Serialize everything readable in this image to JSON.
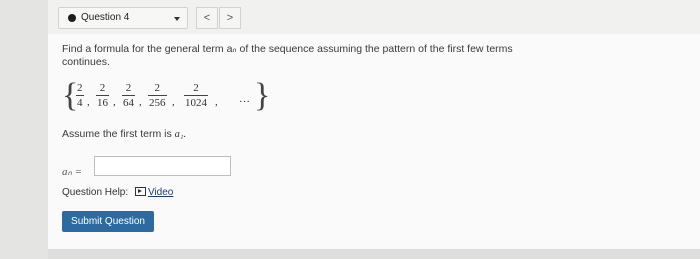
{
  "header": {
    "question_label": "Question 4",
    "prev_label": "<",
    "next_label": ">"
  },
  "question": {
    "prompt": "Find a formula for the general term aₙ of the sequence assuming the pattern of the first few terms continues.",
    "sequence": [
      {
        "num": "2",
        "den": "4"
      },
      {
        "num": "2",
        "den": "16"
      },
      {
        "num": "2",
        "den": "64"
      },
      {
        "num": "2",
        "den": "256"
      },
      {
        "num": "2",
        "den": "1024"
      }
    ],
    "ellipsis": "…",
    "assume_text": "Assume the first term is ",
    "assume_term": "a₁.",
    "answer_label": "aₙ =",
    "answer_value": ""
  },
  "help": {
    "label": "Question Help:",
    "video_icon": "video-play-icon",
    "video_label": "Video"
  },
  "actions": {
    "submit_label": "Submit Question"
  },
  "colors": {
    "submit_bg": "#2c6aa0",
    "link": "#1f3a75"
  }
}
